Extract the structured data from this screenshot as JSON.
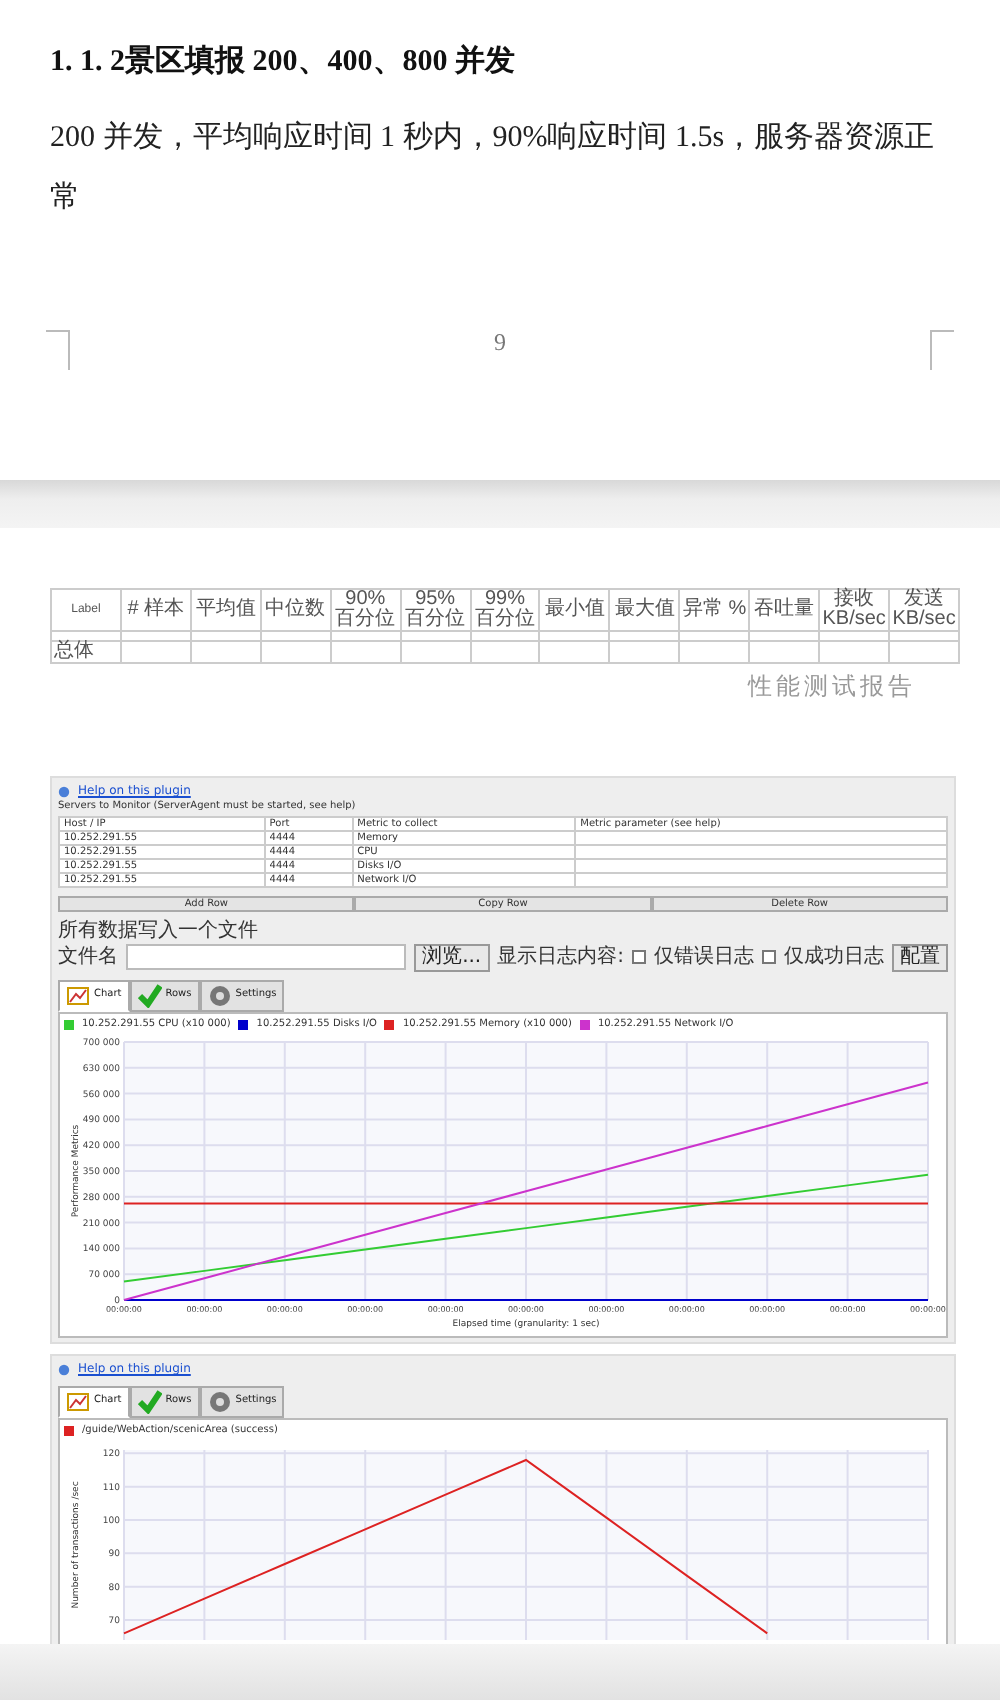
{
  "document": {
    "heading": "1. 1. 2景区填报 200、400、800 并发",
    "paragraph": "200 并发，平均响应时间 1 秒内，90%响应时间 1.5s，服务器资源正常",
    "page_number": "9"
  },
  "report_table": {
    "columns": [
      "Label",
      "# 样本",
      "平均值",
      "中位数",
      "90% 百分位",
      "95% 百分位",
      "99% 百分位",
      "最小值",
      "最大值",
      "异常 %",
      "吞吐量",
      "接收 KB/sec",
      "发送 KB/sec"
    ],
    "rows": [
      {
        "kind": "data"
      },
      {
        "kind": "total",
        "label": "总体"
      }
    ]
  },
  "page_header": "性能测试报告",
  "monitor": {
    "help_link": "Help on this plugin",
    "servers_label": "Servers to Monitor (ServerAgent must be started, see help)",
    "columns": [
      "Host / IP",
      "Port",
      "Metric to collect",
      "Metric parameter (see help)"
    ],
    "rows": [
      [
        "10.252.291.55",
        "4444",
        "Memory"
      ],
      [
        "10.252.291.55",
        "4444",
        "CPU"
      ],
      [
        "10.252.291.55",
        "4444",
        "Disks I/O"
      ],
      [
        "10.252.291.55",
        "4444",
        "Network I/O"
      ]
    ],
    "buttons": [
      "Add Row",
      "Copy Row",
      "Delete Row"
    ],
    "file_note": "所有数据写入一个文件",
    "file_label": "文件名",
    "browse": "浏览...",
    "log_label": "显示日志内容:",
    "log_options": [
      {
        "label": "仅错误日志",
        "checked": false
      },
      {
        "label": "仅成功日志",
        "checked": false
      }
    ],
    "configure": "配置",
    "tabs": [
      {
        "label": "Chart",
        "selected": true
      },
      {
        "label": "Rows",
        "selected": false
      },
      {
        "label": "Settings",
        "selected": false
      }
    ],
    "chart_data": {
      "type": "line",
      "grid": true,
      "legend": "top",
      "xlabel": "Elapsed time (granularity: 1 sec)",
      "ylabel": "Performance Metrics",
      "categories": [
        "00:00:00",
        "00:00:00",
        "00:00:00",
        "00:00:00",
        "00:00:00",
        "00:00:00",
        "00:00:00",
        "00:00:00",
        "00:00:00",
        "00:00:00",
        "00:00:00"
      ],
      "yticks": [
        0,
        70000,
        140000,
        210000,
        280000,
        350000,
        420000,
        490000,
        560000,
        630000,
        700000
      ],
      "ylim": [
        0,
        700000
      ],
      "series": [
        {
          "name": "10.252.291.55 CPU (x10 000)",
          "color": "#33cc33",
          "values": [
            50000,
            79000,
            108000,
            137000,
            166000,
            195000,
            224000,
            253000,
            282000,
            311000,
            340000
          ]
        },
        {
          "name": "10.252.291.55 Disks I/O",
          "color": "#0000cc",
          "values": [
            0,
            0,
            0,
            0,
            0,
            0,
            0,
            0,
            0,
            0,
            0
          ]
        },
        {
          "name": "10.252.291.55 Memory (x10 000)",
          "color": "#dd2222",
          "values": [
            262000,
            262000,
            262000,
            262000,
            262000,
            262000,
            262000,
            262000,
            262000,
            262000,
            262000
          ]
        },
        {
          "name": "10.252.291.55 Network I/O",
          "color": "#cc33cc",
          "values": [
            0,
            59000,
            118000,
            177000,
            236000,
            295000,
            354000,
            413000,
            472000,
            531000,
            590000
          ]
        }
      ]
    }
  },
  "transactions": {
    "help_link": "Help on this plugin",
    "tabs": [
      {
        "label": "Chart",
        "selected": true
      },
      {
        "label": "Rows",
        "selected": false
      },
      {
        "label": "Settings",
        "selected": false
      }
    ],
    "chart_data": {
      "type": "line",
      "grid": true,
      "legend": "top",
      "ylabel": "Number of transactions /sec",
      "categories": [
        null,
        null,
        null,
        null,
        null,
        null,
        null,
        null,
        null,
        null,
        null
      ],
      "ylim": [
        64,
        121
      ],
      "yticks": [
        70,
        80,
        90,
        100,
        110,
        120
      ],
      "series": [
        {
          "name": "/guide/WebAction/scenicArea (success)",
          "color": "#dd2222",
          "values": [
            66,
            76.4,
            86.8,
            97.2,
            107.6,
            118,
            100.7,
            83.3,
            66,
            null,
            null
          ]
        }
      ]
    }
  }
}
